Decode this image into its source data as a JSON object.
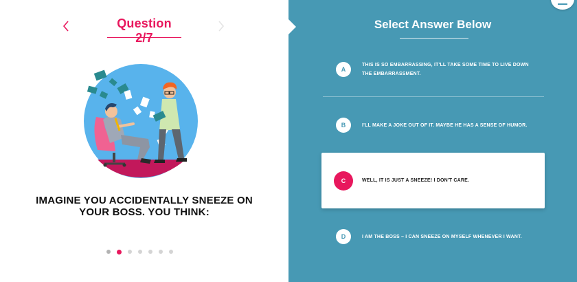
{
  "header": {
    "question_counter": "Question 2/7",
    "prev_icon": "chevron-left-icon",
    "next_icon": "chevron-right-icon"
  },
  "question": {
    "text": "IMAGINE YOU ACCIDENTALLY SNEEZE ON YOUR BOSS. YOU THINK:"
  },
  "progress": {
    "total": 7,
    "current": 2
  },
  "answers_panel": {
    "title": "Select Answer Below",
    "menu_icon": "menu-icon",
    "selected": "C",
    "answers": [
      {
        "letter": "A",
        "text": "THIS IS SO EMBARRASSING, IT'LL TAKE SOME TIME TO LIVE DOWN THE EMBARRASSMENT."
      },
      {
        "letter": "B",
        "text": "I'LL MAKE A JOKE OUT OF IT. MAYBE HE HAS A SENSE OF HUMOR."
      },
      {
        "letter": "C",
        "text": "WELL, IT IS JUST A SNEEZE! I DON'T CARE."
      },
      {
        "letter": "D",
        "text": "I AM THE BOSS – I CAN SNEEZE ON MYSELF WHENEVER I WANT."
      }
    ]
  },
  "colors": {
    "accent": "#e8175d",
    "panel": "#4799b4",
    "illustration_bg": "#58b3ec"
  }
}
